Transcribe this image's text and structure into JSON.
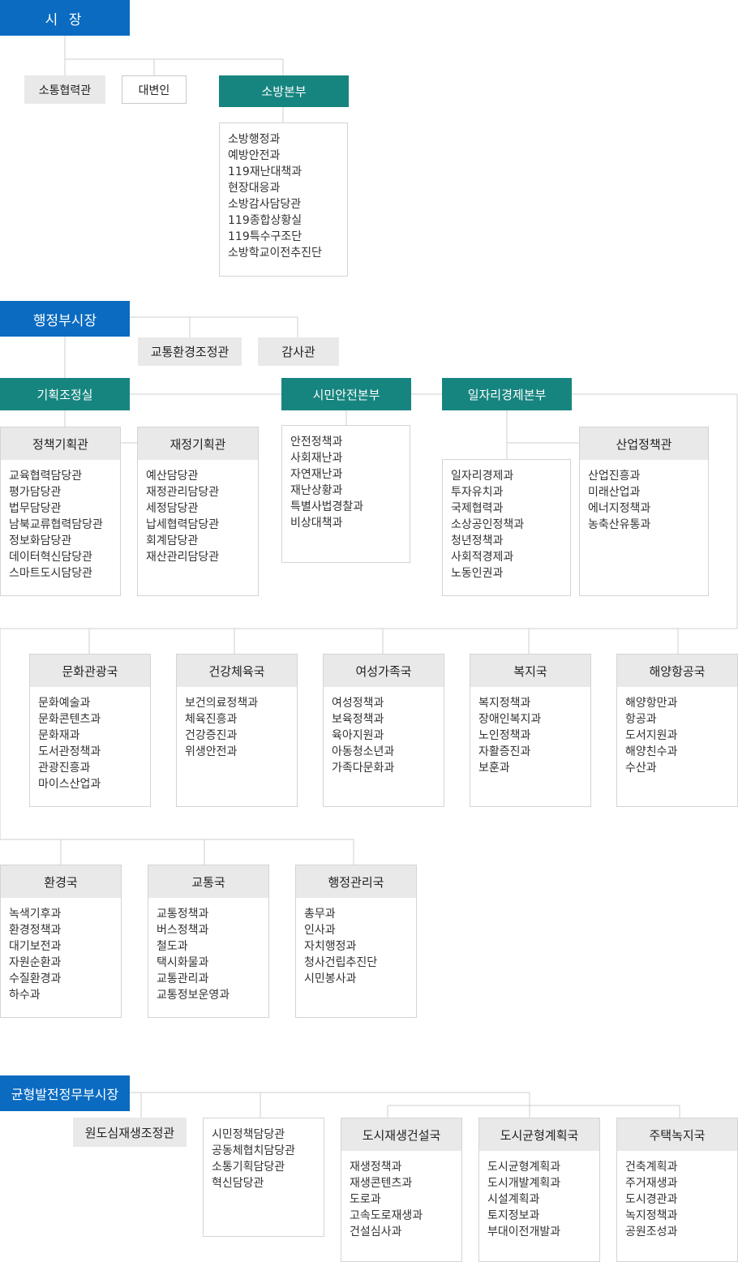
{
  "mayor": {
    "label": "시 장"
  },
  "mayor_staff": {
    "communication": "소통협력관",
    "spokesperson": "대변인"
  },
  "fire_hq": {
    "label": "소방본부",
    "items": [
      "소방행정과",
      "예방안전과",
      "119재난대책과",
      "현장대응과",
      "소방감사담당관",
      "119종합상황실",
      "119특수구조단",
      "소방학교이전추진단"
    ]
  },
  "admin_vice_mayor": {
    "label": "행정부시장",
    "traffic_env": "교통환경조정관",
    "audit": "감사관"
  },
  "planning": {
    "label": "기획조정실",
    "policy": {
      "label": "정책기획관",
      "items": [
        "교육협력담당관",
        "평가담당관",
        "법무담당관",
        "남북교류협력담당관",
        "정보화담당관",
        "데이터혁신담당관",
        "스마트도시담당관"
      ]
    },
    "finance": {
      "label": "재정기획관",
      "items": [
        "예산담당관",
        "재정관리담당관",
        "세정담당관",
        "납세협력담당관",
        "회계담당관",
        "재산관리담당관"
      ]
    }
  },
  "citizen_safety": {
    "label": "시민안전본부",
    "items": [
      "안전정책과",
      "사회재난과",
      "자연재난과",
      "재난상황과",
      "특별사법경찰과",
      "비상대책과"
    ]
  },
  "jobs_economy": {
    "label": "일자리경제본부",
    "items": [
      "일자리경제과",
      "투자유치과",
      "국제협력과",
      "소상공인정책과",
      "청년정책과",
      "사회적경제과",
      "노동인권과"
    ],
    "industry": {
      "label": "산업정책관",
      "items": [
        "산업진흥과",
        "미래산업과",
        "에너지정책과",
        "농축산유통과"
      ]
    }
  },
  "bureaus_row1": [
    {
      "label": "문화관광국",
      "items": [
        "문화예술과",
        "문화콘텐츠과",
        "문화재과",
        "도서관정책과",
        "관광진흥과",
        "마이스산업과"
      ]
    },
    {
      "label": "건강체육국",
      "items": [
        "보건의료정책과",
        "체육진흥과",
        "건강증진과",
        "위생안전과"
      ]
    },
    {
      "label": "여성가족국",
      "items": [
        "여성정책과",
        "보육정책과",
        "육아지원과",
        "아동청소년과",
        "가족다문화과"
      ]
    },
    {
      "label": "복지국",
      "items": [
        "복지정책과",
        "장애인복지과",
        "노인정책과",
        "자활증진과",
        "보훈과"
      ]
    },
    {
      "label": "해양항공국",
      "items": [
        "해양항만과",
        "항공과",
        "도서지원과",
        "해양친수과",
        "수산과"
      ]
    }
  ],
  "bureaus_row2": [
    {
      "label": "환경국",
      "items": [
        "녹색기후과",
        "환경정책과",
        "대기보전과",
        "자원순환과",
        "수질환경과",
        "하수과"
      ]
    },
    {
      "label": "교통국",
      "items": [
        "교통정책과",
        "버스정책과",
        "철도과",
        "택시화물과",
        "교통관리과",
        "교통정보운영과"
      ]
    },
    {
      "label": "행정관리국",
      "items": [
        "총무과",
        "인사과",
        "자치행정과",
        "청사건립추진단",
        "시민봉사과"
      ]
    }
  ],
  "balanced_vice_mayor": {
    "label": "균형발전정무부시장",
    "redevelopment": "원도심재생조정관",
    "officers": [
      "시민정책담당관",
      "공동체협치담당관",
      "소통기획담당관",
      "혁신담당관"
    ]
  },
  "bureaus_row3": [
    {
      "label": "도시재생건설국",
      "items": [
        "재생정책과",
        "재생콘텐츠과",
        "도로과",
        "고속도로재생과",
        "건설심사과"
      ]
    },
    {
      "label": "도시균형계획국",
      "items": [
        "도시균형계획과",
        "도시개발계획과",
        "시설계획과",
        "토지정보과",
        "부대이전개발과"
      ]
    },
    {
      "label": "주택녹지국",
      "items": [
        "건축계획과",
        "주거재생과",
        "도시경관과",
        "녹지정책과",
        "공원조성과"
      ]
    }
  ],
  "colors": {
    "blue": "#0a6bc1",
    "teal": "#17857f",
    "gray": "#e9e9e9",
    "line": "#cfcfcf"
  }
}
